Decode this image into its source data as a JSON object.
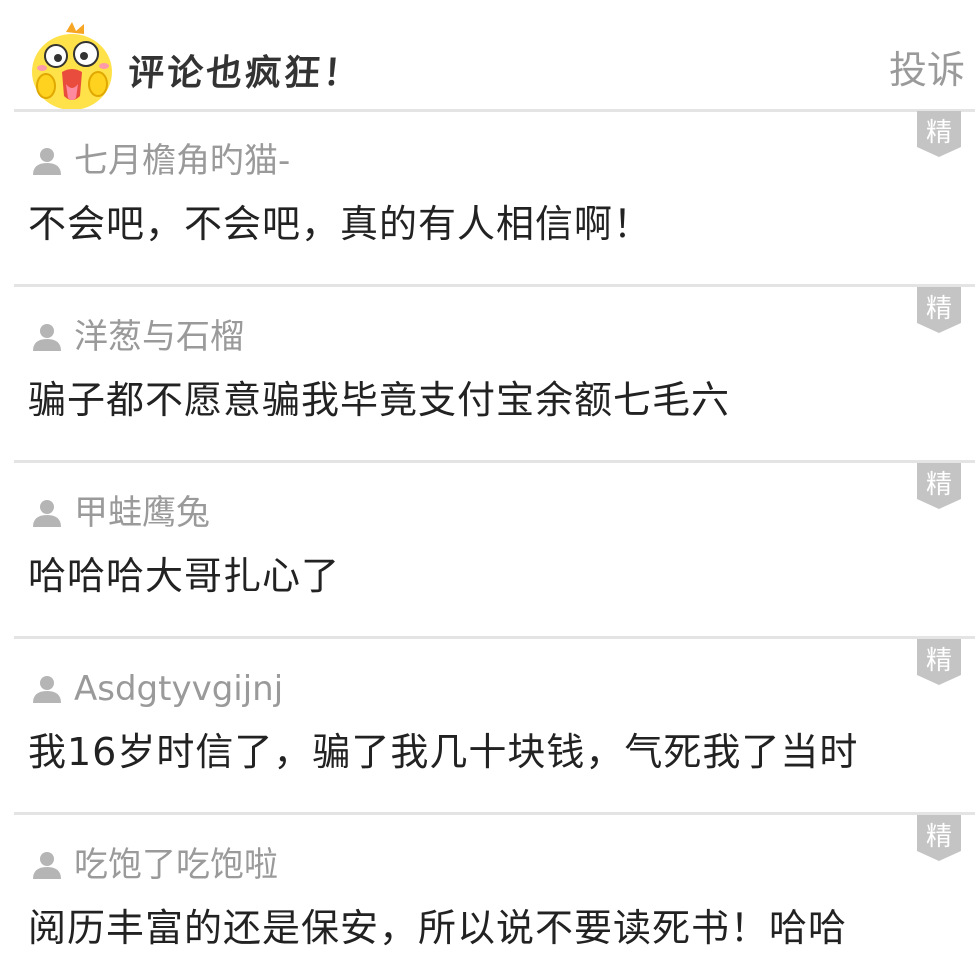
{
  "header": {
    "title": "评论也疯狂！",
    "report_label": "投诉"
  },
  "badge_label": "精",
  "icons": {
    "mascot": "yellow-chick-mascot-icon",
    "user": "user-silhouette-icon",
    "badge": "featured-badge-icon"
  },
  "colors": {
    "username": "#9a9a9a",
    "comment_text": "#222222",
    "divider": "#e4e4e4",
    "badge_fill": "#c4c4c4"
  },
  "comments": [
    {
      "username": "七月檐角旳猫-",
      "text": "不会吧，不会吧，真的有人相信啊！"
    },
    {
      "username": "洋葱与石榴",
      "text": "骗子都不愿意骗我毕竟支付宝余额七毛六"
    },
    {
      "username": "甲蛙鹰兔",
      "text": "哈哈哈大哥扎心了"
    },
    {
      "username": "Asdgtyvgijnj",
      "text": "我16岁时信了，骗了我几十块钱，气死我了当时"
    },
    {
      "username": "吃饱了吃饱啦",
      "text": "阅历丰富的还是保安，所以说不要读死书！哈哈"
    }
  ]
}
